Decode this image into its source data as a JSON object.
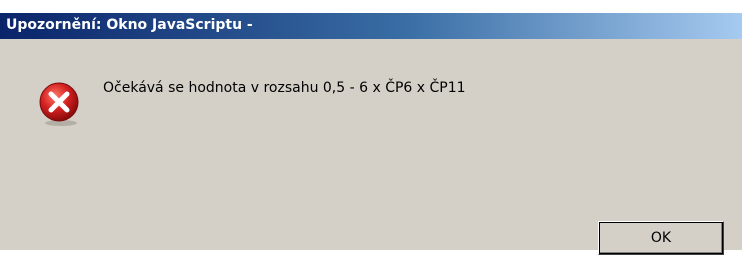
{
  "dialog": {
    "title": "Upozornění: Okno JavaScriptu -",
    "message": "Očekává se hodnota v rozsahu 0,5 - 6 x ČP6 x ČP11",
    "ok_label": "OK",
    "icon": "error-icon"
  },
  "colors": {
    "titlebar_start": "#0a246a",
    "titlebar_end": "#a6caf0",
    "dialog_background": "#d4d0c8",
    "error_icon_red": "#d42020"
  }
}
